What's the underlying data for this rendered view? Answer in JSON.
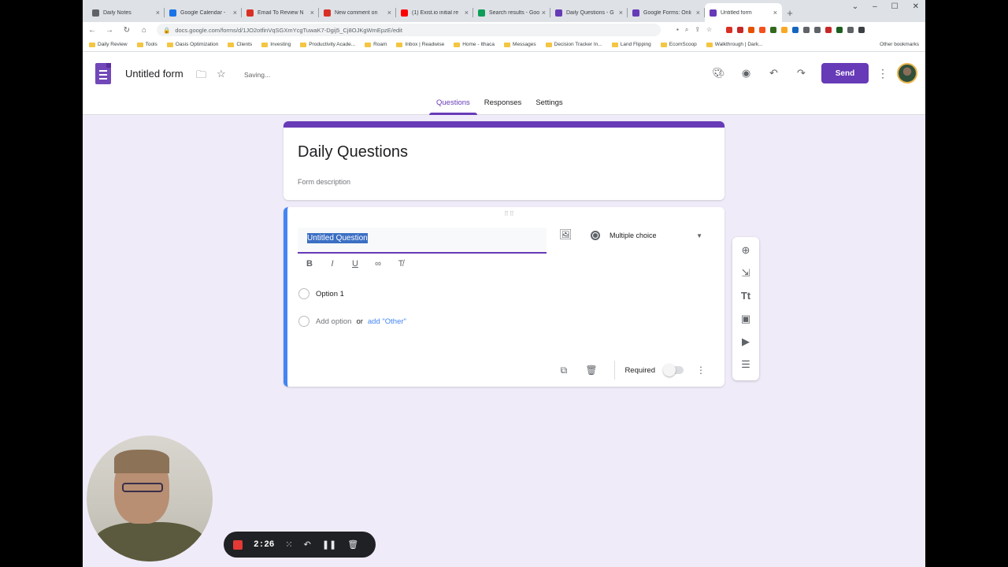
{
  "browser": {
    "tabs": [
      {
        "label": "Daily Notes",
        "color": "#5f6368"
      },
      {
        "label": "Google Calendar -",
        "color": "#1a73e8"
      },
      {
        "label": "Email To Review N",
        "color": "#d93025"
      },
      {
        "label": "New comment on",
        "color": "#d93025"
      },
      {
        "label": "(1) Exist.io initial re",
        "color": "#ff0000"
      },
      {
        "label": "Search results - Goo",
        "color": "#0f9d58"
      },
      {
        "label": "Daily Questions - G",
        "color": "#673ab7"
      },
      {
        "label": "Google Forms: Onli",
        "color": "#673ab7"
      },
      {
        "label": "Untitled form",
        "color": "#673ab7",
        "active": true
      }
    ],
    "close_glyph": "×",
    "new_tab_glyph": "+",
    "url": "docs.google.com/forms/d/1JO2otfinVqSGXmYcgTuwaK7-Dgij5_Cj8OJKgWmEpzE/edit",
    "bookmarks": [
      "Daily Review",
      "Tools",
      "Oasis Optimization",
      "Clients",
      "Investing",
      "Productivity Acade...",
      "Roam",
      "Inbox | Readwise",
      "Home - Ithaca",
      "Messages",
      "Decision Tracker In...",
      "Land Flipping",
      "EcomScoop",
      "Walkthrough | Dark..."
    ],
    "other_bookmarks": "Other bookmarks"
  },
  "header": {
    "form_title": "Untitled form",
    "status": "Saving...",
    "send_label": "Send",
    "tabs": [
      "Questions",
      "Responses",
      "Settings"
    ],
    "active_tab": "Questions"
  },
  "form": {
    "title": "Daily Questions",
    "description_placeholder": "Form description"
  },
  "question": {
    "title": "Untitled Question",
    "type": "Multiple choice",
    "options": [
      "Option 1"
    ],
    "add_option": "Add option",
    "or": "or",
    "add_other": "add \"Other\"",
    "required_label": "Required",
    "required": false
  },
  "recorder": {
    "time": "2:26"
  },
  "help_glyph": "?",
  "colors": {
    "accent": "#673ab7",
    "page_bg": "#f0ebf8",
    "question_edge": "#4285f4"
  }
}
